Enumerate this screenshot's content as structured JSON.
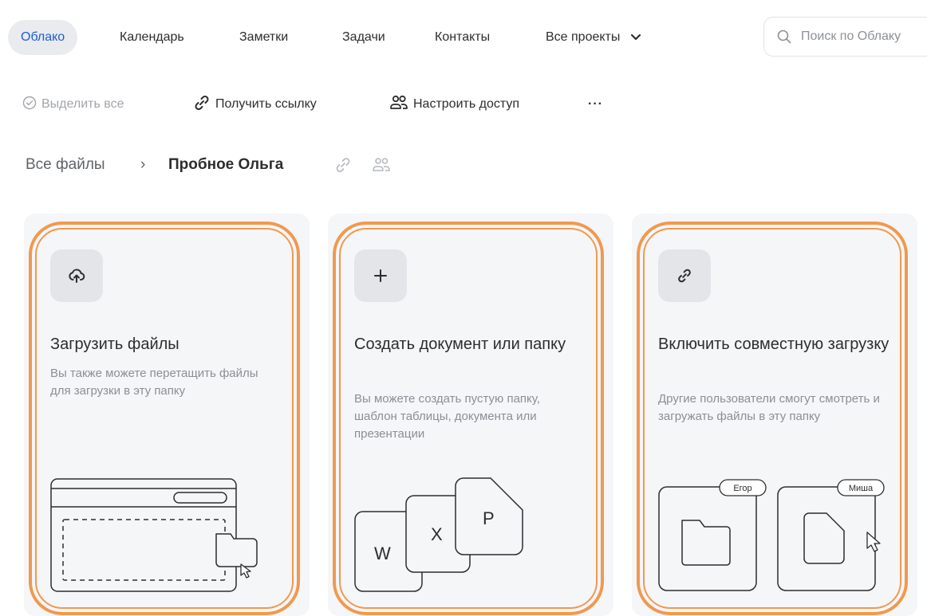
{
  "nav": {
    "tabs": [
      {
        "label": "Облако",
        "active": true
      },
      {
        "label": "Календарь"
      },
      {
        "label": "Заметки"
      },
      {
        "label": "Задачи"
      },
      {
        "label": "Контакты"
      },
      {
        "label": "Все проекты"
      }
    ],
    "search_placeholder": "Поиск по Облаку"
  },
  "toolbar": {
    "select_all": "Выделить все",
    "get_link": "Получить ссылку",
    "access": "Настроить доступ",
    "more": "···"
  },
  "breadcrumb": {
    "root": "Все файлы",
    "separator": "›",
    "current": "Пробное Ольга"
  },
  "cards": [
    {
      "icon": "upload-cloud-icon",
      "title": "Загрузить файлы",
      "description": "Вы также можете перетащить файлы для загрузки в эту папку"
    },
    {
      "icon": "plus-icon",
      "title": "Создать документ или папку",
      "description": "Вы можете создать пустую папку, шаблон таблицы, документа или презентации",
      "doc_letters": [
        "W",
        "X",
        "P"
      ]
    },
    {
      "icon": "link-icon",
      "title": "Включить совместную загрузку",
      "description": "Другие пользователи смогут смотреть и загружать файлы в эту папку",
      "users": [
        "Егор",
        "Миша"
      ]
    }
  ],
  "colors": {
    "accent": "#1f5ed8",
    "highlight": "#f0994f",
    "card_bg": "#f5f6f8"
  }
}
